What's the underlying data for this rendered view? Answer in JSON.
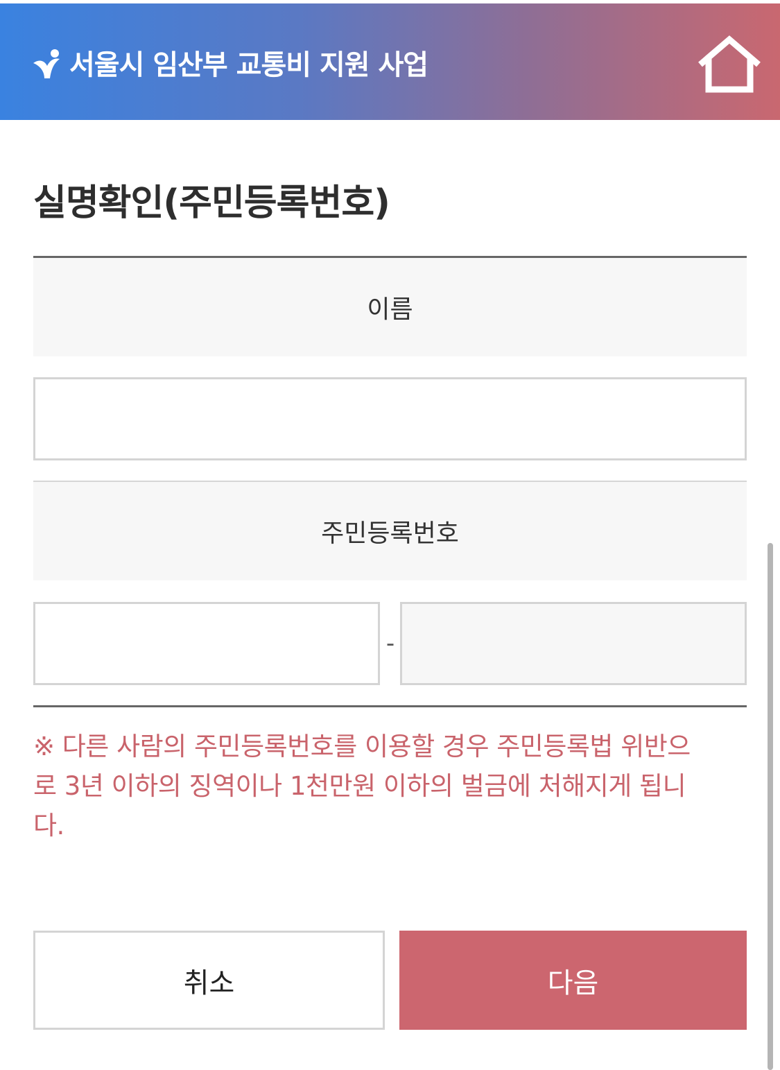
{
  "header": {
    "title": "서울시 임산부 교통비 지원 사업",
    "logo_icon": "seoul-logo-icon",
    "home_icon": "home-icon",
    "gradient_start": "#3a82e0",
    "gradient_end": "#c96870"
  },
  "page": {
    "title": "실명확인(주민등록번호)"
  },
  "form": {
    "name_label": "이름",
    "name_value": "",
    "rrn_label": "주민등록번호",
    "rrn_front_value": "",
    "rrn_back_value": "",
    "rrn_separator": "-"
  },
  "warning": {
    "text": "※ 다른 사람의 주민등록번호를 이용할 경우 주민등록법 위반으로 3년 이하의 징역이나 1천만원 이하의 벌금에 처해지게 됩니다.",
    "color": "#c9636b"
  },
  "buttons": {
    "cancel_label": "취소",
    "next_label": "다음",
    "next_color": "#cc666f"
  }
}
